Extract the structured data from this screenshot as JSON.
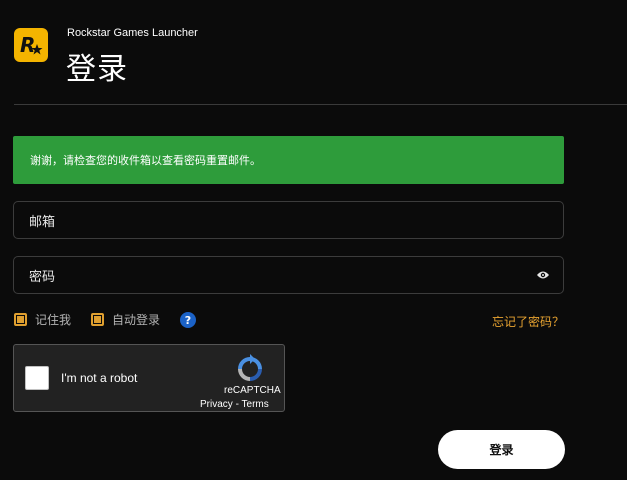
{
  "header": {
    "app_title": "Rockstar Games Launcher",
    "page_title": "登录",
    "logo_icon": "rockstar-logo-icon"
  },
  "banner": {
    "message": "谢谢，请检查您的收件箱以查看密码重置邮件。",
    "color": "#2e9c3b"
  },
  "form": {
    "email_placeholder": "邮箱",
    "password_placeholder": "密码",
    "password_toggle_icon": "eye-icon",
    "remember_label": "记住我",
    "autologin_label": "自动登录",
    "help_icon": "help-icon",
    "help_glyph": "?",
    "forgot_link": "忘记了密码？",
    "submit_label": "登录"
  },
  "recaptcha": {
    "label": "I'm not a robot",
    "brand": "reCAPTCHA",
    "privacy": "Privacy",
    "separator": "-",
    "terms": "Terms"
  },
  "colors": {
    "background": "#0b0b0b",
    "accent": "#e9a431",
    "logo": "#f4b400",
    "success": "#2e9c3b"
  }
}
